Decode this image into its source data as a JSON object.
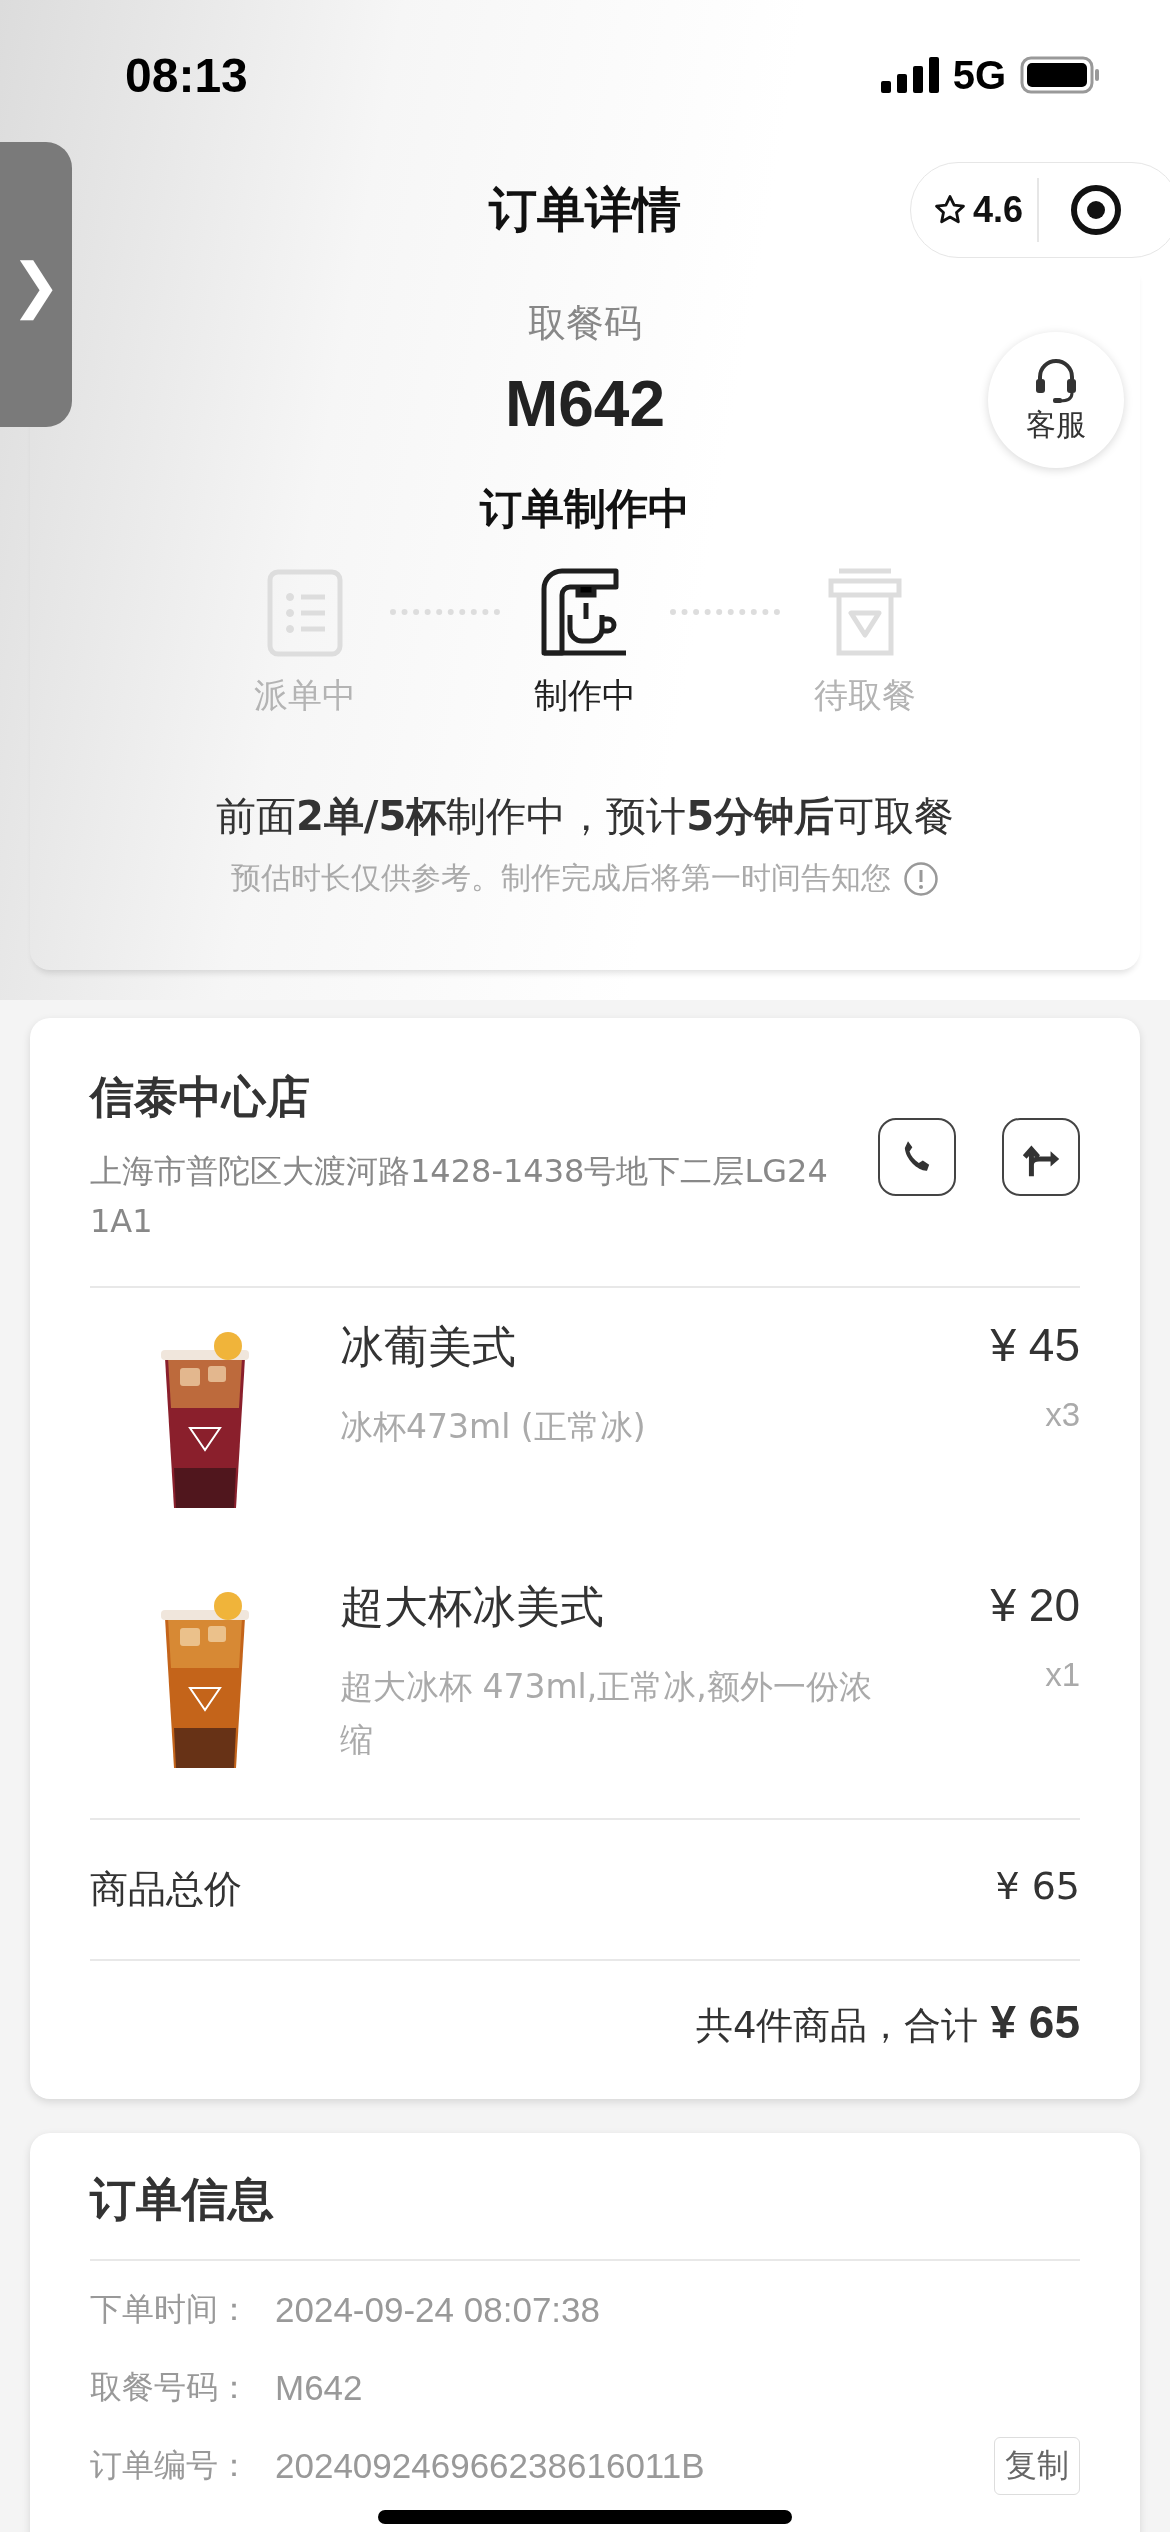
{
  "status_bar": {
    "time": "08:13",
    "network": "5G"
  },
  "nav": {
    "title": "订单详情",
    "rating": "4.6"
  },
  "side_tab": {
    "glyph": "❯"
  },
  "pickup": {
    "label": "取餐码",
    "code": "M642",
    "status": "订单制作中",
    "service": "客服",
    "steps": [
      {
        "kind": "dispatch",
        "label": "派单中",
        "selected": false
      },
      {
        "kind": "brewing",
        "label": "制作中",
        "selected": true
      },
      {
        "kind": "pickup",
        "label": "待取餐",
        "selected": false
      }
    ],
    "message": "前面**2单/5杯**制作中，预计**5分钟后**可取餐",
    "note": "预估时长仅供参考。制作完成后将第一时间告知您"
  },
  "store": {
    "name": "信泰中心店",
    "address": "上海市普陀区大渡河路1428-1438号地下二层LG241A1",
    "items": [
      {
        "name": "冰葡美式",
        "spec": "冰杯473ml (正常冰)",
        "price": "¥ 45",
        "qty": "x3",
        "color": "#8a1f2c"
      },
      {
        "name": "超大杯冰美式",
        "spec": "超大冰杯 473ml,正常冰,额外一份浓缩",
        "price": "¥ 20",
        "qty": "x1",
        "color": "#c4641a"
      }
    ],
    "subtotal_label": "商品总价",
    "subtotal": "¥ 65",
    "summary": "共4件商品，合计",
    "total": "¥ 65"
  },
  "order_info": {
    "title": "订单信息",
    "copy": "复制",
    "rows": [
      {
        "label": "下单时间：",
        "value": "2024-09-24 08:07:38"
      },
      {
        "label": "取餐号码：",
        "value": "M642"
      },
      {
        "label": "订单编号：",
        "value": "202409246966238616011B"
      }
    ]
  }
}
